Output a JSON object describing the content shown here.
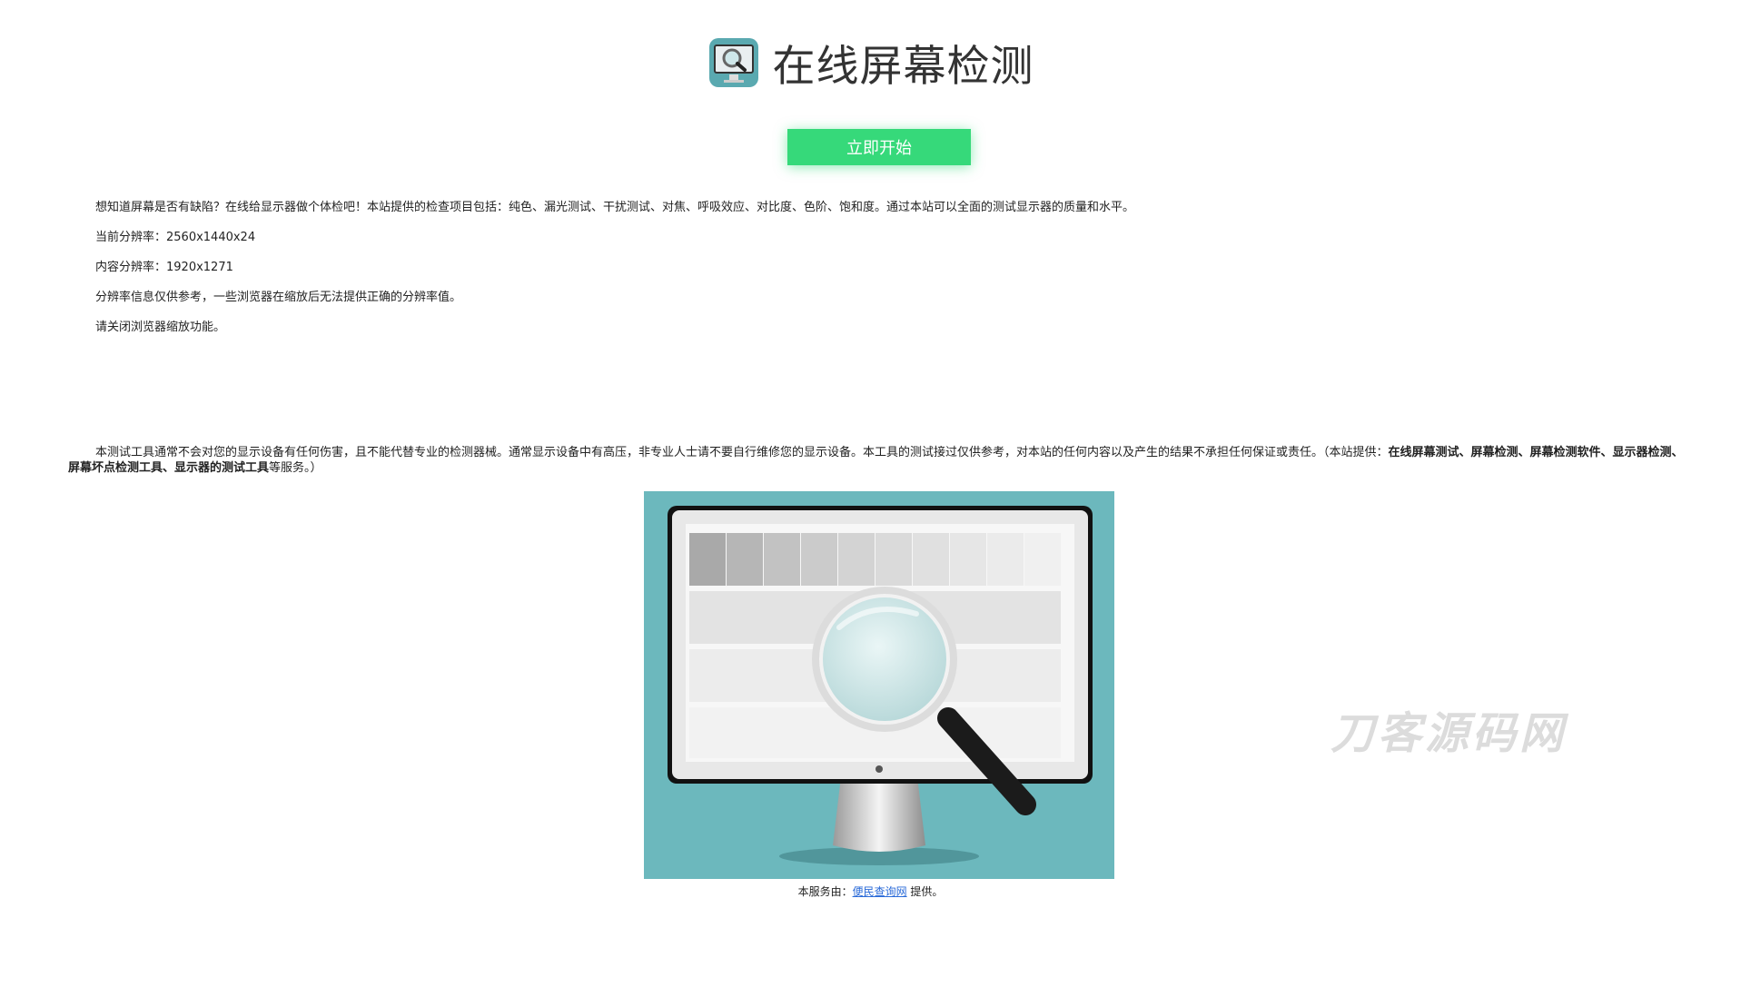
{
  "header": {
    "title": "在线屏幕检测",
    "logo_icon": "monitor-magnifier-icon"
  },
  "cta": {
    "start_label": "立即开始",
    "color": "#36d97a"
  },
  "info": {
    "intro": "想知道屏幕是否有缺陷？在线给显示器做个体检吧！本站提供的检查项目包括：纯色、漏光测试、干扰测试、对焦、呼吸效应、对比度、色阶、饱和度。通过本站可以全面的测试显示器的质量和水平。",
    "current_resolution": "当前分辨率：2560x1440x24",
    "content_resolution": "内容分辨率：1920x1271",
    "notice": "分辨率信息仅供参考，一些浏览器在缩放后无法提供正确的分辨率值。",
    "zoom_tip": "请关闭浏览器缩放功能。"
  },
  "disclaimer": {
    "text": "本测试工具通常不会对您的显示设备有任何伤害，且不能代替专业的检测器械。通常显示设备中有高压，非专业人士请不要自行维修您的显示设备。本工具的测试接过仅供参考，对本站的任何内容以及产生的结果不承担任何保证或责任。（本站提供：",
    "keywords": "在线屏幕测试、屏幕检测、屏幕检测软件、显示器检测、屏幕坏点检测工具、显示器的测试工具",
    "suffix": "等服务。）"
  },
  "hero": {
    "background": "#6cb8bd",
    "icon": "monitor-magnifier-illustration"
  },
  "credit": {
    "prefix": "本服务由：",
    "link_text": "便民查询网",
    "suffix": " 提供。"
  },
  "watermark": "刀客源码网"
}
